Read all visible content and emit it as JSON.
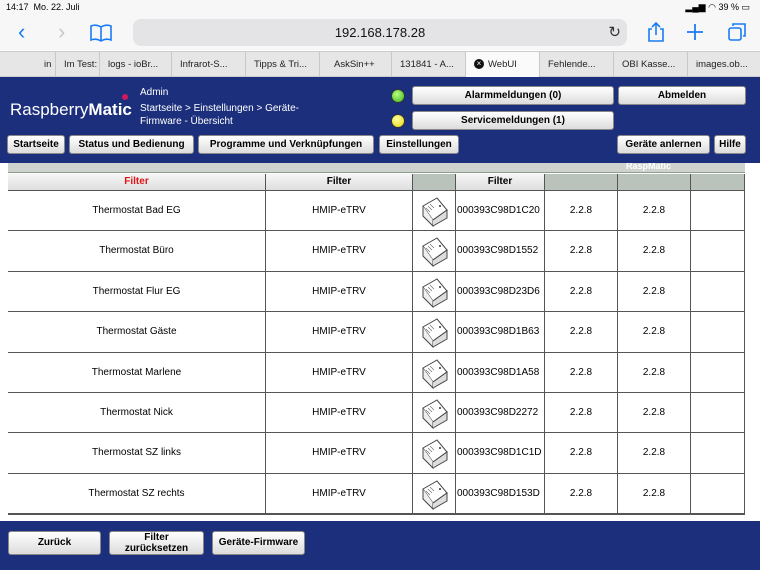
{
  "status_bar": {
    "time": "14:17",
    "date": "Mo. 22. Juli",
    "battery": "39 %"
  },
  "browser": {
    "url": "192.168.178.28",
    "back_glyph": "‹",
    "forward_glyph": "›",
    "tabs": [
      {
        "label": "in"
      },
      {
        "label": "Im Test:"
      },
      {
        "label": "logs - ioBr..."
      },
      {
        "label": "Infrarot-S..."
      },
      {
        "label": "Tipps & Tri..."
      },
      {
        "label": "AskSin++"
      },
      {
        "label": "131841 - A..."
      },
      {
        "label": "WebUI",
        "active": true
      },
      {
        "label": "Fehlende..."
      },
      {
        "label": "OBI Kasse..."
      },
      {
        "label": "images.ob..."
      }
    ]
  },
  "header": {
    "logo_part1": "Raspberry",
    "logo_part2": "Matic",
    "user": "Admin",
    "breadcrumb": "Startseite > Einstellungen > Geräte-Firmware - Übersicht",
    "alarm_button": "Alarmmeldungen (0)",
    "service_button": "Servicemeldungen (1)",
    "logout_button": "Abmelden",
    "nav": {
      "startseite": "Startseite",
      "status": "Status und Bedienung",
      "programme": "Programme und Verknüpfungen",
      "einstellungen": "Einstellungen",
      "anlernen": "Geräte anlernen",
      "hilfe": "Hilfe"
    }
  },
  "table": {
    "top_header_partial": "RaspMatic",
    "filters": {
      "name": "Filter",
      "type": "Filter",
      "serial": "Filter"
    },
    "rows": [
      {
        "name": "Thermostat Bad EG",
        "type": "HMIP-eTRV",
        "serial": "000393C98D1C20",
        "fw": "2.2.8",
        "available": "2.2.8"
      },
      {
        "name": "Thermostat Büro",
        "type": "HMIP-eTRV",
        "serial": "000393C98D1552",
        "fw": "2.2.8",
        "available": "2.2.8"
      },
      {
        "name": "Thermostat Flur EG",
        "type": "HMIP-eTRV",
        "serial": "000393C98D23D6",
        "fw": "2.2.8",
        "available": "2.2.8"
      },
      {
        "name": "Thermostat Gäste",
        "type": "HMIP-eTRV",
        "serial": "000393C98D1B63",
        "fw": "2.2.8",
        "available": "2.2.8"
      },
      {
        "name": "Thermostat Marlene",
        "type": "HMIP-eTRV",
        "serial": "000393C98D1A58",
        "fw": "2.2.8",
        "available": "2.2.8"
      },
      {
        "name": "Thermostat Nick",
        "type": "HMIP-eTRV",
        "serial": "000393C98D2272",
        "fw": "2.2.8",
        "available": "2.2.8"
      },
      {
        "name": "Thermostat SZ links",
        "type": "HMIP-eTRV",
        "serial": "000393C98D1C1D",
        "fw": "2.2.8",
        "available": "2.2.8"
      },
      {
        "name": "Thermostat SZ rechts",
        "type": "HMIP-eTRV",
        "serial": "000393C98D153D",
        "fw": "2.2.8",
        "available": "2.2.8"
      }
    ]
  },
  "footer": {
    "back": "Zurück",
    "reset_line1": "Filter",
    "reset_line2": "zurücksetzen",
    "firmware": "Geräte-Firmware"
  },
  "colors": {
    "header_bg": "#1c2f7c",
    "filter_active": "#e01616"
  }
}
